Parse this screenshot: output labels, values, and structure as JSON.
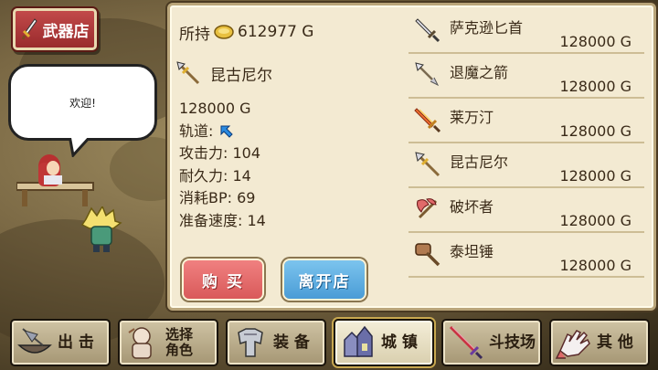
{
  "shop": {
    "title": "武器店",
    "greeting": "欢迎!"
  },
  "wallet": {
    "label": "所持",
    "amount": "612977 G"
  },
  "selected_item": {
    "name": "昆古尼尔",
    "price": "128000 G",
    "trajectory_label": "轨道:",
    "attack": "攻击力: 104",
    "durability": "耐久力: 14",
    "bp_cost": "消耗BP: 69",
    "ready_speed": "准备速度: 14"
  },
  "actions": {
    "buy": "购 买",
    "leave": "离开店"
  },
  "items": [
    {
      "name": "萨克逊匕首",
      "price": "128000 G",
      "icon": "dagger-icon"
    },
    {
      "name": "退魔之箭",
      "price": "128000 G",
      "icon": "arrow-icon"
    },
    {
      "name": "莱万汀",
      "price": "128000 G",
      "icon": "flame-sword-icon"
    },
    {
      "name": "昆古尼尔",
      "price": "128000 G",
      "icon": "spear-icon"
    },
    {
      "name": "破坏者",
      "price": "128000 G",
      "icon": "axe-icon"
    },
    {
      "name": "泰坦锤",
      "price": "128000 G",
      "icon": "hammer-icon"
    }
  ],
  "nav": [
    {
      "label": "出 击",
      "icon": "ship-icon"
    },
    {
      "label1": "选择",
      "label2": "角色",
      "icon": "character-icon"
    },
    {
      "label": "装 备",
      "icon": "armor-icon"
    },
    {
      "label": "城 镇",
      "icon": "town-icon",
      "active": true
    },
    {
      "label": "斗技场",
      "icon": "arena-sword-icon"
    },
    {
      "label": "其 他",
      "icon": "hand-icon"
    }
  ],
  "colors": {
    "panel": "#f3ead2",
    "buy": "#e46c6c",
    "leave": "#5fb0e2",
    "title_bg": "#b03a3c"
  }
}
